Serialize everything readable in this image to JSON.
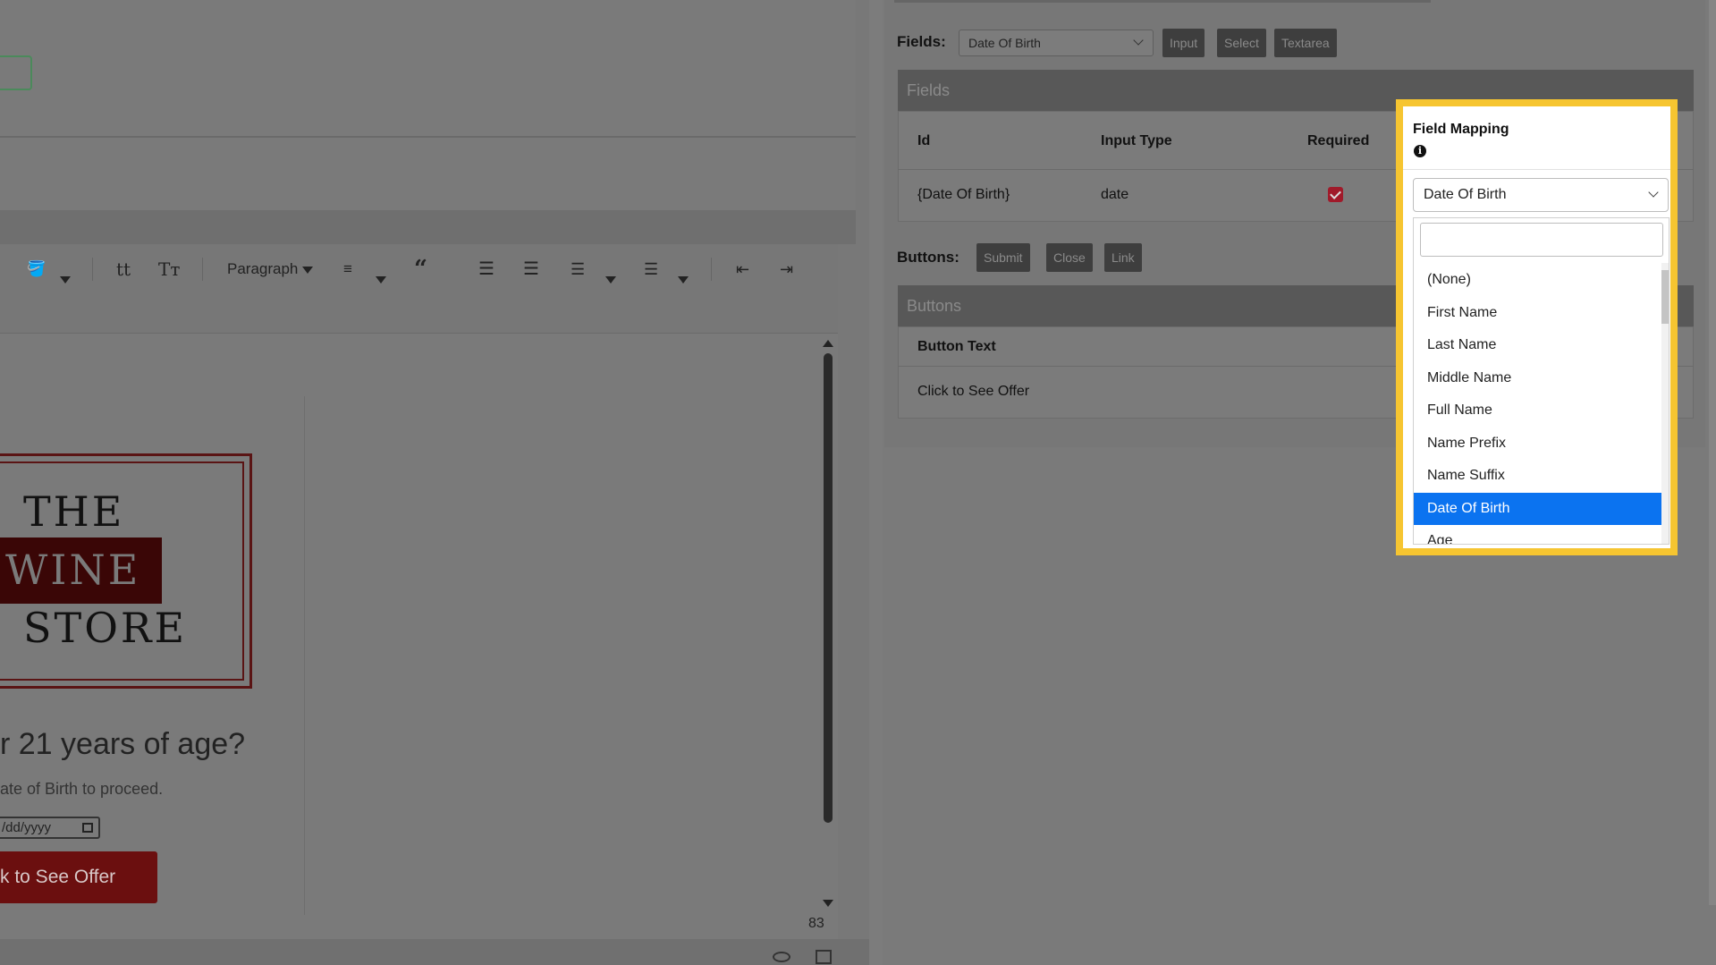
{
  "editor": {
    "toolbar": {
      "paragraph_label": "Paragraph",
      "tt_small": "tt",
      "tt_large": "Tт",
      "quote_icon": "“"
    },
    "logo": {
      "line1": "THE",
      "line2": "WINE",
      "line3": "STORE"
    },
    "age_question": "r 21 years of age?",
    "age_sub": "ate of Birth to proceed.",
    "date_placeholder": "/dd/yyyy",
    "offer_button": "k to See Offer",
    "counter": "83"
  },
  "fields_bar": {
    "label": "Fields:",
    "selected": "Date Of Birth",
    "buttons": [
      "Input",
      "Select",
      "Textarea"
    ]
  },
  "fields_section": {
    "title": "Fields",
    "headers": {
      "id": "Id",
      "input_type": "Input Type",
      "required": "Required"
    },
    "row": {
      "id": "{Date Of Birth}",
      "input_type": "date",
      "required": true
    }
  },
  "buttons_bar": {
    "label": "Buttons:",
    "buttons": [
      "Submit",
      "Close",
      "Link"
    ]
  },
  "buttons_section": {
    "title": "Buttons",
    "header": "Button Text",
    "row": "Click to See Offer"
  },
  "field_mapping": {
    "title": "Field Mapping",
    "info_icon": "i",
    "selected": "Date Of Birth",
    "options": [
      "(None)",
      "First Name",
      "Last Name",
      "Middle Name",
      "Full Name",
      "Name Prefix",
      "Name Suffix",
      "Date Of Birth",
      "Age"
    ],
    "highlight_color": "#f6c531",
    "selected_color": "#0b73f0"
  }
}
